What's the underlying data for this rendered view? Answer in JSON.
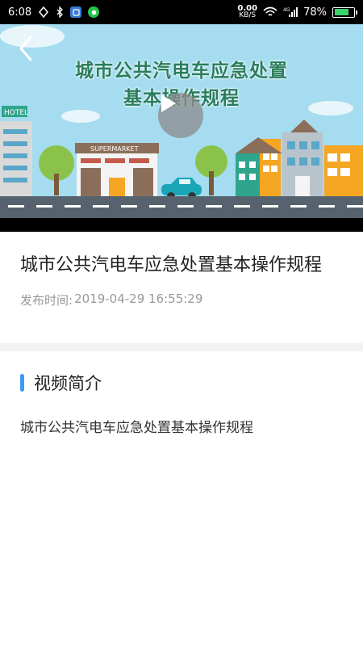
{
  "status_bar": {
    "time": "6:08",
    "net_speed_value": "0.00",
    "net_speed_unit": "KB/S",
    "network": "4G",
    "battery": "78%",
    "battery_level": 0.78
  },
  "video": {
    "title_line1": "城市公共汽电车应急处置",
    "title_line2": "基本操作规程",
    "hotel_sign": "HOTEL",
    "supermarket_sign": "SUPERMARKET"
  },
  "info": {
    "title": "城市公共汽电车应急处置基本操作规程",
    "pubtime_label": "发布时间:",
    "pubtime_value": "2019-04-29 16:55:29"
  },
  "intro": {
    "heading": "视频简介",
    "text": "城市公共汽电车应急处置基本操作规程"
  },
  "colors": {
    "accent_bar": "#3b9bf2",
    "video_title": "#2a7d5d"
  }
}
